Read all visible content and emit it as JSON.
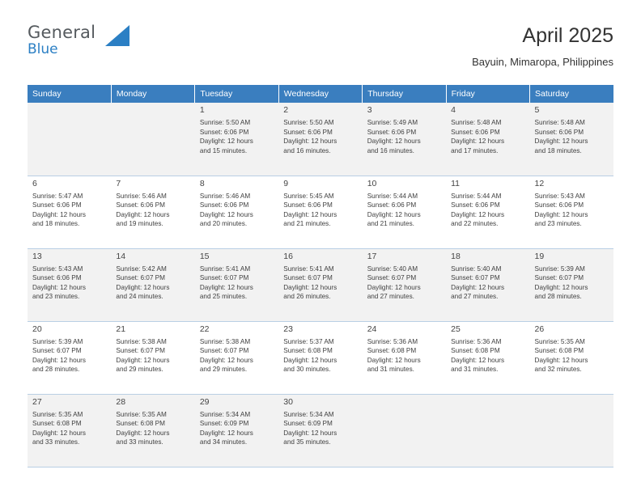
{
  "logo": {
    "word1": "General",
    "word2": "Blue",
    "accent": "#2b7fc4"
  },
  "header": {
    "title": "April 2025",
    "subtitle": "Bayuin, Mimaropa, Philippines"
  },
  "calendar": {
    "header_bg": "#3a7ebf",
    "weekdays": [
      "Sunday",
      "Monday",
      "Tuesday",
      "Wednesday",
      "Thursday",
      "Friday",
      "Saturday"
    ],
    "weeks": [
      {
        "shaded": true,
        "days": [
          {
            "num": "",
            "lines": []
          },
          {
            "num": "",
            "lines": []
          },
          {
            "num": "1",
            "lines": [
              "Sunrise: 5:50 AM",
              "Sunset: 6:06 PM",
              "Daylight: 12 hours",
              "and 15 minutes."
            ]
          },
          {
            "num": "2",
            "lines": [
              "Sunrise: 5:50 AM",
              "Sunset: 6:06 PM",
              "Daylight: 12 hours",
              "and 16 minutes."
            ]
          },
          {
            "num": "3",
            "lines": [
              "Sunrise: 5:49 AM",
              "Sunset: 6:06 PM",
              "Daylight: 12 hours",
              "and 16 minutes."
            ]
          },
          {
            "num": "4",
            "lines": [
              "Sunrise: 5:48 AM",
              "Sunset: 6:06 PM",
              "Daylight: 12 hours",
              "and 17 minutes."
            ]
          },
          {
            "num": "5",
            "lines": [
              "Sunrise: 5:48 AM",
              "Sunset: 6:06 PM",
              "Daylight: 12 hours",
              "and 18 minutes."
            ]
          }
        ]
      },
      {
        "shaded": false,
        "days": [
          {
            "num": "6",
            "lines": [
              "Sunrise: 5:47 AM",
              "Sunset: 6:06 PM",
              "Daylight: 12 hours",
              "and 18 minutes."
            ]
          },
          {
            "num": "7",
            "lines": [
              "Sunrise: 5:46 AM",
              "Sunset: 6:06 PM",
              "Daylight: 12 hours",
              "and 19 minutes."
            ]
          },
          {
            "num": "8",
            "lines": [
              "Sunrise: 5:46 AM",
              "Sunset: 6:06 PM",
              "Daylight: 12 hours",
              "and 20 minutes."
            ]
          },
          {
            "num": "9",
            "lines": [
              "Sunrise: 5:45 AM",
              "Sunset: 6:06 PM",
              "Daylight: 12 hours",
              "and 21 minutes."
            ]
          },
          {
            "num": "10",
            "lines": [
              "Sunrise: 5:44 AM",
              "Sunset: 6:06 PM",
              "Daylight: 12 hours",
              "and 21 minutes."
            ]
          },
          {
            "num": "11",
            "lines": [
              "Sunrise: 5:44 AM",
              "Sunset: 6:06 PM",
              "Daylight: 12 hours",
              "and 22 minutes."
            ]
          },
          {
            "num": "12",
            "lines": [
              "Sunrise: 5:43 AM",
              "Sunset: 6:06 PM",
              "Daylight: 12 hours",
              "and 23 minutes."
            ]
          }
        ]
      },
      {
        "shaded": true,
        "days": [
          {
            "num": "13",
            "lines": [
              "Sunrise: 5:43 AM",
              "Sunset: 6:06 PM",
              "Daylight: 12 hours",
              "and 23 minutes."
            ]
          },
          {
            "num": "14",
            "lines": [
              "Sunrise: 5:42 AM",
              "Sunset: 6:07 PM",
              "Daylight: 12 hours",
              "and 24 minutes."
            ]
          },
          {
            "num": "15",
            "lines": [
              "Sunrise: 5:41 AM",
              "Sunset: 6:07 PM",
              "Daylight: 12 hours",
              "and 25 minutes."
            ]
          },
          {
            "num": "16",
            "lines": [
              "Sunrise: 5:41 AM",
              "Sunset: 6:07 PM",
              "Daylight: 12 hours",
              "and 26 minutes."
            ]
          },
          {
            "num": "17",
            "lines": [
              "Sunrise: 5:40 AM",
              "Sunset: 6:07 PM",
              "Daylight: 12 hours",
              "and 27 minutes."
            ]
          },
          {
            "num": "18",
            "lines": [
              "Sunrise: 5:40 AM",
              "Sunset: 6:07 PM",
              "Daylight: 12 hours",
              "and 27 minutes."
            ]
          },
          {
            "num": "19",
            "lines": [
              "Sunrise: 5:39 AM",
              "Sunset: 6:07 PM",
              "Daylight: 12 hours",
              "and 28 minutes."
            ]
          }
        ]
      },
      {
        "shaded": false,
        "days": [
          {
            "num": "20",
            "lines": [
              "Sunrise: 5:39 AM",
              "Sunset: 6:07 PM",
              "Daylight: 12 hours",
              "and 28 minutes."
            ]
          },
          {
            "num": "21",
            "lines": [
              "Sunrise: 5:38 AM",
              "Sunset: 6:07 PM",
              "Daylight: 12 hours",
              "and 29 minutes."
            ]
          },
          {
            "num": "22",
            "lines": [
              "Sunrise: 5:38 AM",
              "Sunset: 6:07 PM",
              "Daylight: 12 hours",
              "and 29 minutes."
            ]
          },
          {
            "num": "23",
            "lines": [
              "Sunrise: 5:37 AM",
              "Sunset: 6:08 PM",
              "Daylight: 12 hours",
              "and 30 minutes."
            ]
          },
          {
            "num": "24",
            "lines": [
              "Sunrise: 5:36 AM",
              "Sunset: 6:08 PM",
              "Daylight: 12 hours",
              "and 31 minutes."
            ]
          },
          {
            "num": "25",
            "lines": [
              "Sunrise: 5:36 AM",
              "Sunset: 6:08 PM",
              "Daylight: 12 hours",
              "and 31 minutes."
            ]
          },
          {
            "num": "26",
            "lines": [
              "Sunrise: 5:35 AM",
              "Sunset: 6:08 PM",
              "Daylight: 12 hours",
              "and 32 minutes."
            ]
          }
        ]
      },
      {
        "shaded": true,
        "days": [
          {
            "num": "27",
            "lines": [
              "Sunrise: 5:35 AM",
              "Sunset: 6:08 PM",
              "Daylight: 12 hours",
              "and 33 minutes."
            ]
          },
          {
            "num": "28",
            "lines": [
              "Sunrise: 5:35 AM",
              "Sunset: 6:08 PM",
              "Daylight: 12 hours",
              "and 33 minutes."
            ]
          },
          {
            "num": "29",
            "lines": [
              "Sunrise: 5:34 AM",
              "Sunset: 6:09 PM",
              "Daylight: 12 hours",
              "and 34 minutes."
            ]
          },
          {
            "num": "30",
            "lines": [
              "Sunrise: 5:34 AM",
              "Sunset: 6:09 PM",
              "Daylight: 12 hours",
              "and 35 minutes."
            ]
          },
          {
            "num": "",
            "lines": []
          },
          {
            "num": "",
            "lines": []
          },
          {
            "num": "",
            "lines": []
          }
        ]
      }
    ]
  }
}
